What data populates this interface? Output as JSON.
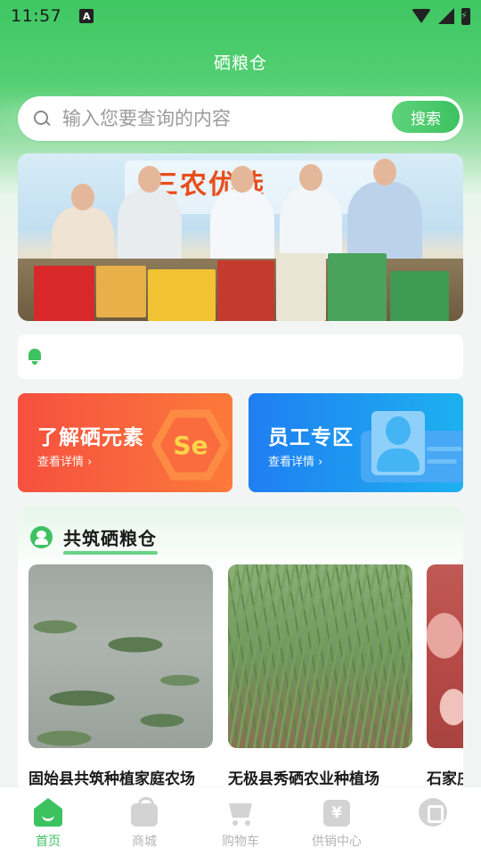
{
  "status": {
    "time": "11:57",
    "notif_badge": "A"
  },
  "header": {
    "title": "硒粮仓"
  },
  "search": {
    "placeholder": "输入您要查询的内容",
    "button": "搜索"
  },
  "banner": {
    "slogan": "三农优选"
  },
  "notice": {
    "text": ""
  },
  "cards": [
    {
      "title": "了解硒元素",
      "link": "查看详情 ›",
      "emblem": "Se",
      "color": "#f6503f"
    },
    {
      "title": "员工专区",
      "link": "查看详情 ›",
      "color": "#1f7ef2"
    }
  ],
  "section": {
    "title": "共筑硒粮仓",
    "farms": [
      {
        "name": "固始县共筑种植家庭农场"
      },
      {
        "name": "无极县秀硒农业种植场"
      },
      {
        "name": "石家庄"
      }
    ]
  },
  "tabbar": {
    "items": [
      {
        "label": "首页",
        "icon": "home-icon",
        "active": true
      },
      {
        "label": "商城",
        "icon": "bag-icon"
      },
      {
        "label": "购物车",
        "icon": "cart-icon"
      },
      {
        "label": "供销中心",
        "icon": "yen-icon"
      },
      {
        "label": "",
        "icon": "coin-icon"
      }
    ]
  },
  "colors": {
    "brand_green": "#3dc260",
    "search_button": "#4fca6f"
  }
}
